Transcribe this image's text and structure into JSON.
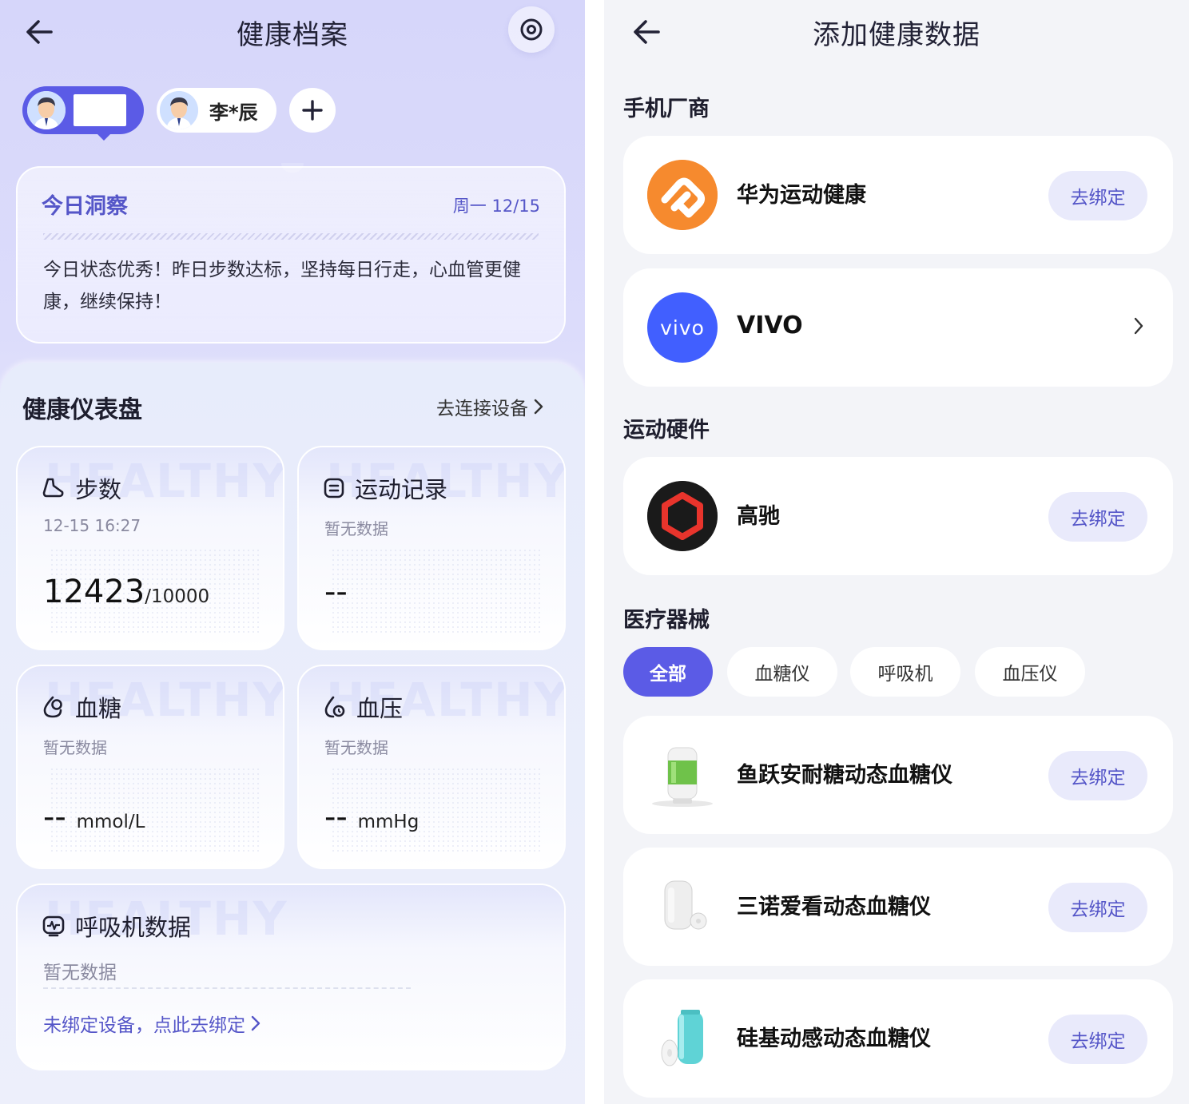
{
  "left": {
    "title": "健康档案",
    "profiles": [
      {
        "name": ""
      },
      {
        "name": "李*辰"
      }
    ],
    "insight": {
      "title": "今日洞察",
      "date": "周一 12/15",
      "text": "今日状态优秀！昨日步数达标，坚持每日行走，心血管更健康，继续保持！"
    },
    "dashboard": {
      "title": "健康仪表盘",
      "connect_link": "去连接设备",
      "cards": {
        "steps": {
          "title": "步数",
          "time": "12-15 16:27",
          "value": "12423",
          "goal": "/10000",
          "watermark": "HEALTHY"
        },
        "exercise": {
          "title": "运动记录",
          "time": "暂无数据",
          "value": "--",
          "watermark": "HEALTHY"
        },
        "glucose": {
          "title": "血糖",
          "time": "暂无数据",
          "value": "--",
          "unit": "mmol/L",
          "watermark": "HEALTHY"
        },
        "pressure": {
          "title": "血压",
          "time": "暂无数据",
          "value": "--",
          "unit": "mmHg",
          "watermark": "HEALTHY"
        },
        "ventilator": {
          "title": "呼吸机数据",
          "time": "暂无数据",
          "link": "未绑定设备，点此去绑定",
          "watermark": "HEALTHY"
        }
      }
    }
  },
  "right": {
    "title": "添加健康数据",
    "sections": {
      "phone": "手机厂商",
      "sport": "运动硬件",
      "medical": "医疗器械"
    },
    "phone_vendors": [
      {
        "name": "华为运动健康",
        "action": "去绑定"
      },
      {
        "name": "VIVO",
        "logo_text": "vivo"
      }
    ],
    "sport_hardware": [
      {
        "name": "高驰",
        "action": "去绑定"
      }
    ],
    "filters": [
      "全部",
      "血糖仪",
      "呼吸机",
      "血压仪"
    ],
    "active_filter": "全部",
    "devices": [
      {
        "name": "鱼跃安耐糖动态血糖仪",
        "action": "去绑定"
      },
      {
        "name": "三诺爱看动态血糖仪",
        "action": "去绑定"
      },
      {
        "name": "硅基动感动态血糖仪",
        "action": "去绑定"
      }
    ],
    "colors": {
      "accent": "#5b5be6",
      "huawei": "#f5842a",
      "vivo": "#415fff",
      "coros": "#e8342c"
    }
  }
}
